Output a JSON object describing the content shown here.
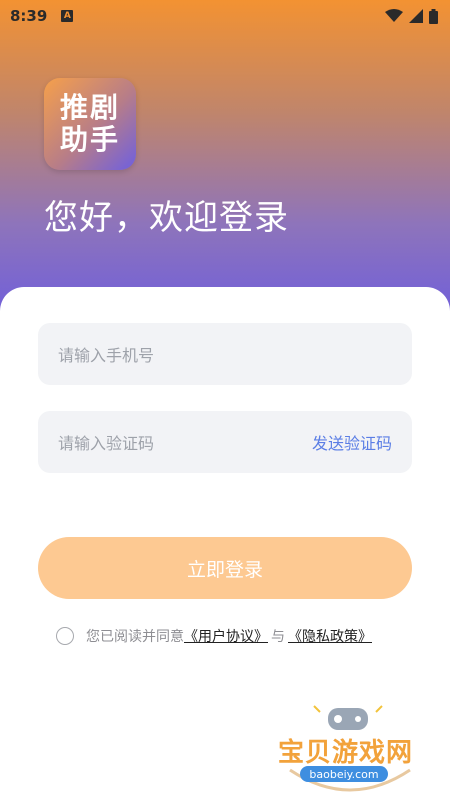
{
  "status_bar": {
    "time": "8:39",
    "notification_badge": "A"
  },
  "logo": {
    "line1": "推剧",
    "line2": "助手"
  },
  "welcome_text": "您好，欢迎登录",
  "form": {
    "phone_placeholder": "请输入手机号",
    "code_placeholder": "请输入验证码",
    "send_code_label": "发送验证码",
    "login_label": "立即登录"
  },
  "agreement": {
    "prefix": "您已阅读并同意",
    "user_agreement": "《用户协议》",
    "connector": "与",
    "privacy_policy": "《隐私政策》"
  },
  "watermark": {
    "text": "宝贝游戏网",
    "url": "baobeiy.com"
  },
  "colors": {
    "accent": "#5B7EE5",
    "login_button": "#FDC992",
    "gradient_top": "#F39232",
    "gradient_bottom": "#6F5EDB"
  }
}
